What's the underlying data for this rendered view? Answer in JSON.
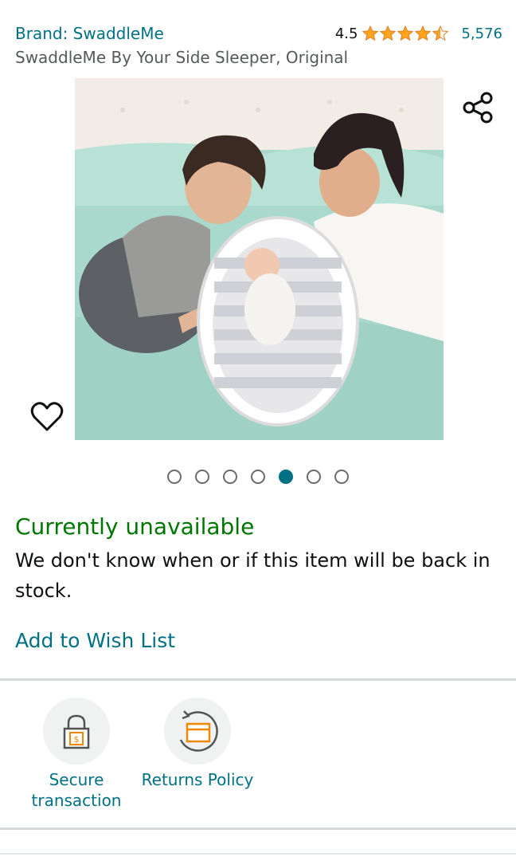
{
  "header": {
    "brand_label": "Brand: SwaddleMe",
    "rating_value": "4.5",
    "rating_stars": 4.5,
    "rating_count": "5,576",
    "title": "SwaddleMe By Your Side Sleeper, Original"
  },
  "gallery": {
    "image_alt": "Parents with baby in bedside sleeper",
    "total_images": 7,
    "active_index": 4
  },
  "availability": {
    "status": "Currently unavailable",
    "description": "We don't know when or if this item will be back in stock."
  },
  "actions": {
    "wishlist_label": "Add to Wish List"
  },
  "features": [
    {
      "icon": "lock-icon",
      "label": "Secure transaction"
    },
    {
      "icon": "returns-box-icon",
      "label": "Returns Policy"
    }
  ],
  "colors": {
    "link": "#007185",
    "available_green": "#007600",
    "star": "#ffa41c"
  }
}
